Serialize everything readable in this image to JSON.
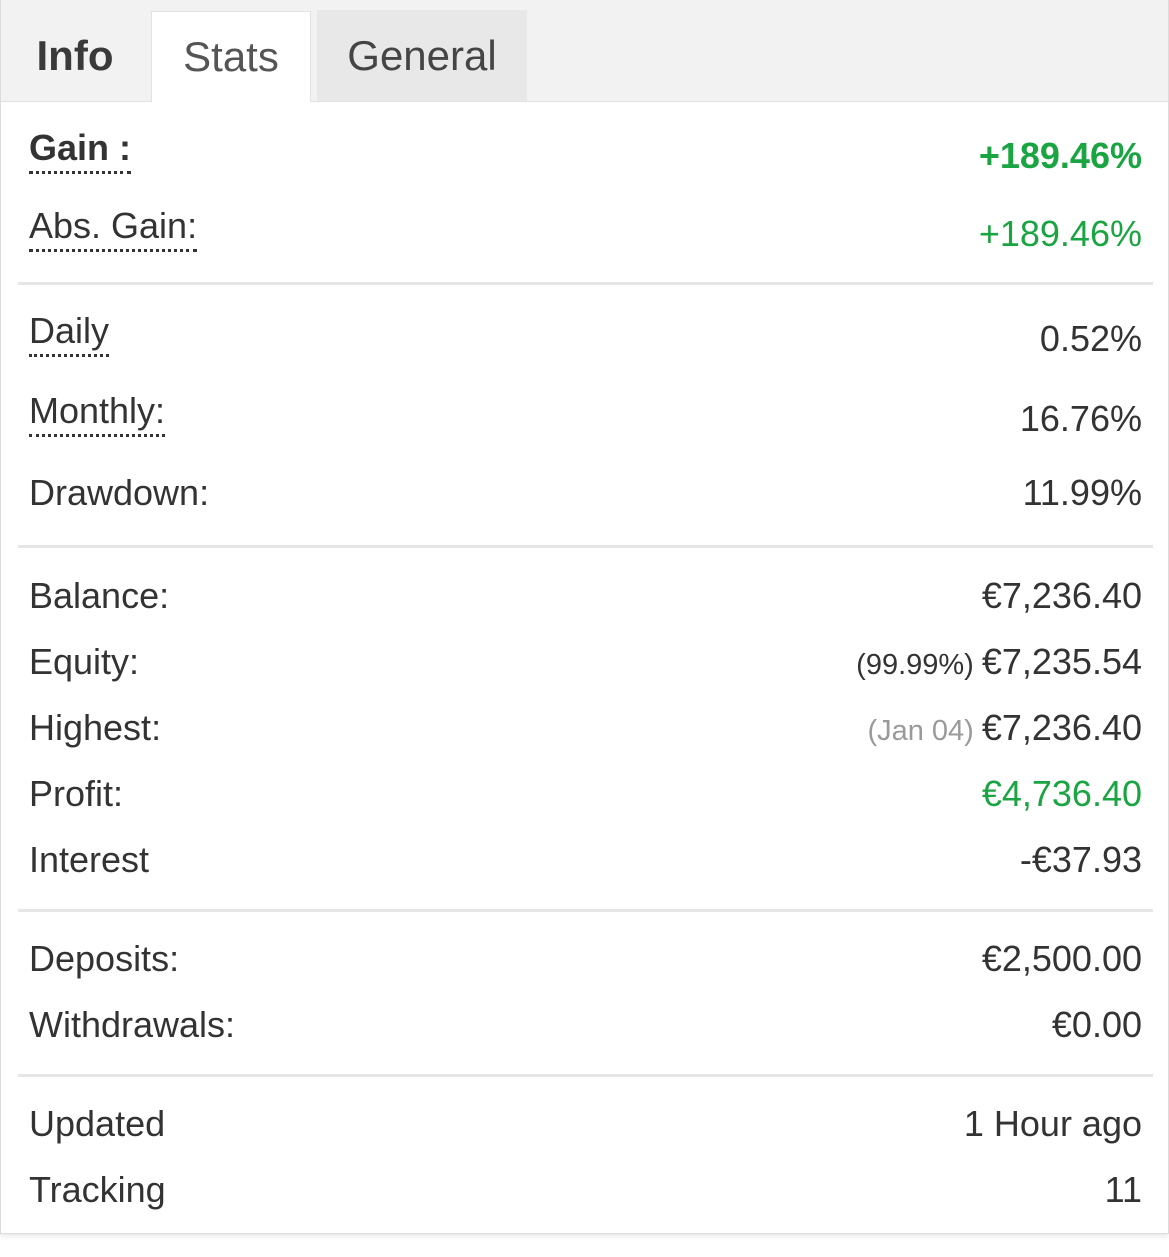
{
  "tabs": [
    {
      "label": "Info"
    },
    {
      "label": "Stats"
    },
    {
      "label": "General"
    }
  ],
  "gain": {
    "label": "Gain :",
    "value": "+189.46%"
  },
  "abs_gain": {
    "label": "Abs. Gain:",
    "value": "+189.46%"
  },
  "daily": {
    "label": "Daily",
    "value": "0.52%"
  },
  "monthly": {
    "label": "Monthly:",
    "value": "16.76%"
  },
  "drawdown": {
    "label": "Drawdown:",
    "value": "11.99%"
  },
  "balance": {
    "label": "Balance:",
    "value": "€7,236.40"
  },
  "equity": {
    "label": "Equity:",
    "note": "(99.99%)",
    "value": "€7,235.54"
  },
  "highest": {
    "label": "Highest:",
    "note": "(Jan 04)",
    "value": "€7,236.40"
  },
  "profit": {
    "label": "Profit:",
    "value": "€4,736.40"
  },
  "interest": {
    "label": "Interest",
    "value": "-€37.93"
  },
  "deposits": {
    "label": "Deposits:",
    "value": "€2,500.00"
  },
  "withdrawals": {
    "label": "Withdrawals:",
    "value": "€0.00"
  },
  "updated": {
    "label": "Updated",
    "value": "1 Hour ago"
  },
  "tracking": {
    "label": "Tracking",
    "value": "11"
  },
  "colors": {
    "positive": "#1aa442",
    "text": "#333333",
    "muted": "#9a9a9a",
    "tab_bar": "#f2f2f2"
  }
}
